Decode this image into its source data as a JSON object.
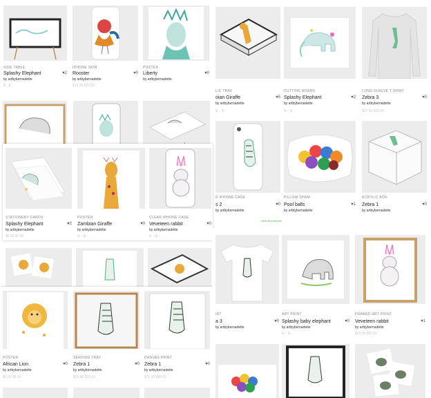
{
  "panels": [
    {
      "id": "top-left",
      "cards": [
        {
          "category": "SIDE TABLE",
          "title": "Splashy Elephant",
          "likes": "2",
          "by": "by artbybernadette",
          "price": "$·· $···",
          "art": "table"
        },
        {
          "category": "IPHONE SKIN",
          "title": "Rooster",
          "likes": "0",
          "by": "by artbybernadette",
          "price": "$19.99 $20.00",
          "art": "rooster"
        },
        {
          "category": "POSTER",
          "title": "Liberty",
          "likes": "0",
          "by": "by artbybernadette",
          "price": "",
          "art": "liberty"
        }
      ]
    },
    {
      "id": "top-right",
      "cards": [
        {
          "category": "LIC TRAY",
          "title": "oian Giraffe",
          "likes": "5",
          "by": "by artbybernadette",
          "price": "$··· $···",
          "art": "tray"
        },
        {
          "category": "CUTTING BOARD",
          "title": "Splashy Elephant",
          "likes": "2",
          "by": "by artbybernadette",
          "price": "$··· $···",
          "art": "elephant-board"
        },
        {
          "category": "LONG SLEEVE T-SHIRT",
          "title": "Zebra 3",
          "likes": "0",
          "by": "by artbybernadette",
          "price": "$27.99 $33.00",
          "art": "longsleeve"
        },
        {
          "category": "R IPHONE CASE",
          "title": "s 2",
          "likes": "0",
          "by": "by artbybernadette",
          "price": "",
          "art": "zebra-phone"
        },
        {
          "category": "PILLOW SHAM",
          "title": "Pool balls",
          "likes": "1",
          "by": "by artbybernadette",
          "price": "",
          "art": "pillow"
        },
        {
          "category": "ACRYLIC BOX",
          "title": "Zebra 1",
          "likes": "0",
          "by": "by artbybernadette",
          "price": "",
          "art": "acrylic"
        }
      ],
      "footer_link": "view all products"
    },
    {
      "id": "mid-left",
      "cards": [
        {
          "category": "",
          "title": "",
          "likes": "",
          "by": "",
          "price": "",
          "art": "elephant-frame"
        },
        {
          "category": "",
          "title": "",
          "likes": "",
          "by": "",
          "price": "",
          "art": "liberty-phone"
        },
        {
          "category": "",
          "title": "",
          "likes": "",
          "by": "",
          "price": "",
          "art": "elephant-table"
        }
      ]
    },
    {
      "id": "mid-overlay",
      "cards": [
        {
          "category": "STATIONERY CARDS",
          "title": "Splashy Elephant",
          "likes": "2",
          "by": "by artbybernadette",
          "price": "$6.00 $7.00",
          "art": "cards"
        },
        {
          "category": "POSTER",
          "title": "Zambian Giraffe",
          "likes": "0",
          "by": "by artbybernadette",
          "price": "$··· $···",
          "art": "giraffe"
        },
        {
          "category": "CLEAR IPHONE CASE",
          "title": "Veveteen rabbit",
          "likes": "0",
          "by": "by artbybernadette",
          "price": "$··· $···",
          "art": "rabbit-phone"
        }
      ]
    },
    {
      "id": "bottom-left-back",
      "cards": [
        {
          "category": "",
          "title": "",
          "likes": "",
          "by": "",
          "price": "",
          "art": "lion-coasters"
        },
        {
          "category": "",
          "title": "",
          "likes": "",
          "by": "",
          "price": "",
          "art": "zebra-plain"
        },
        {
          "category": "",
          "title": "",
          "likes": "",
          "by": "",
          "price": "",
          "art": "lion-table"
        }
      ]
    },
    {
      "id": "bottom-left",
      "cards": [
        {
          "category": "POSTER",
          "title": "African Lion",
          "likes": "0",
          "by": "by artbybernadette",
          "price": "$6.00 $6.00",
          "art": "lion"
        },
        {
          "category": "SERVING TRAY",
          "title": "Zebra 1",
          "likes": "0",
          "by": "by artbybernadette",
          "price": "$29.99 $33.00",
          "art": "zebra-tray"
        },
        {
          "category": "CANVAS PRINT",
          "title": "Zebra 1",
          "likes": "0",
          "by": "by artbybernadette",
          "price": "$79.99 $84.00",
          "art": "zebra-canvas"
        }
      ]
    },
    {
      "id": "bottom-right",
      "cards": [
        {
          "category": "IRT",
          "title": "a 3",
          "likes": "0",
          "by": "by artbybernadette",
          "price": "",
          "art": "tshirt"
        },
        {
          "category": "ART PRINT",
          "title": "Splashy baby elephant",
          "likes": "0",
          "by": "by artbybernadette",
          "price": "$··· $···",
          "art": "baby-elephant"
        },
        {
          "category": "FRAMED ART PRINT",
          "title": "Veveteen rabbit",
          "likes": "1",
          "by": "by artbybernadette",
          "price": "$42.99 $50.00",
          "art": "rabbit-frame"
        },
        {
          "category": "",
          "title": "",
          "likes": "",
          "by": "",
          "price": "",
          "art": "pool-towel"
        },
        {
          "category": "",
          "title": "",
          "likes": "",
          "by": "",
          "price": "",
          "art": "zebra-framed"
        },
        {
          "category": "",
          "title": "",
          "likes": "",
          "by": "",
          "price": "",
          "art": "guinea-coasters"
        }
      ]
    }
  ],
  "colors": {
    "accent_link": "#4caf50",
    "heart": "#555555",
    "muted": "#888888"
  }
}
